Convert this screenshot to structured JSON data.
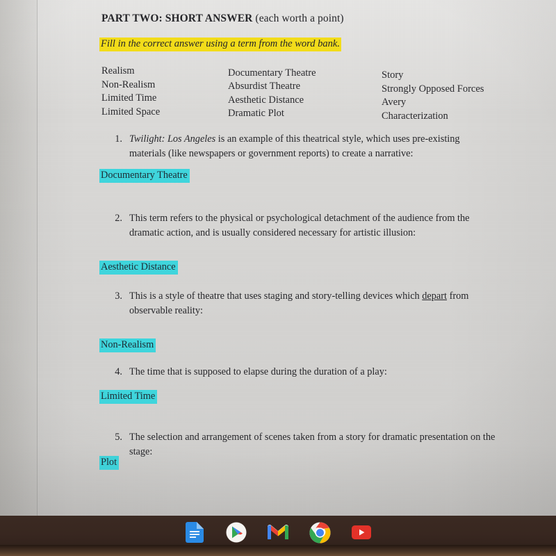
{
  "document": {
    "heading_bold": "PART TWO: SHORT ANSWER",
    "heading_rest": " (each worth a point)",
    "instruction": "Fill in the correct answer using a term from the word bank.",
    "word_bank": {
      "column1": [
        "Realism",
        "Non-Realism",
        "Limited Time",
        "Limited Space"
      ],
      "column2": [
        "Documentary Theatre",
        "Absurdist Theatre",
        "Aesthetic Distance",
        "Dramatic Plot"
      ],
      "column3": [
        "Story",
        "Strongly Opposed Forces",
        "Avery",
        "Characterization"
      ]
    },
    "questions": [
      {
        "number": "1.",
        "text_italic_lead": "Twilight: Los Angeles",
        "text_rest": " is an example of this theatrical style, which uses pre-existing materials (like newspapers or government reports) to create a narrative:",
        "answer": "Documentary Theatre"
      },
      {
        "number": "2.",
        "text": "This term refers to the physical or psychological detachment of the audience from the dramatic action, and is usually considered necessary for artistic illusion:",
        "answer": "Aesthetic Distance"
      },
      {
        "number": "3.",
        "text_before": "This is a style of theatre that uses staging and story-telling devices which ",
        "text_underlined": "depart",
        "text_after": " from observable reality:",
        "answer": "Non-Realism"
      },
      {
        "number": "4.",
        "text": "The time that is supposed to elapse during the duration of a play:",
        "answer": "Limited Time"
      },
      {
        "number": "5.",
        "text": "The selection and arrangement of scenes taken from a story for dramatic presentation on the stage:",
        "answer": "Plot"
      }
    ]
  },
  "shelf": {
    "items": [
      {
        "name": "google-docs-icon",
        "label": "Google Docs"
      },
      {
        "name": "play-store-icon",
        "label": "Play Store"
      },
      {
        "name": "gmail-icon",
        "label": "Gmail"
      },
      {
        "name": "chrome-icon",
        "label": "Chrome"
      },
      {
        "name": "youtube-icon",
        "label": "YouTube"
      }
    ],
    "active_item": "chrome-icon"
  },
  "colors": {
    "highlight_yellow": "#f2dc1a",
    "highlight_cyan": "#3fd5dc",
    "paper": "#dedddb",
    "shelf": "#382720",
    "text": "#27272b"
  }
}
